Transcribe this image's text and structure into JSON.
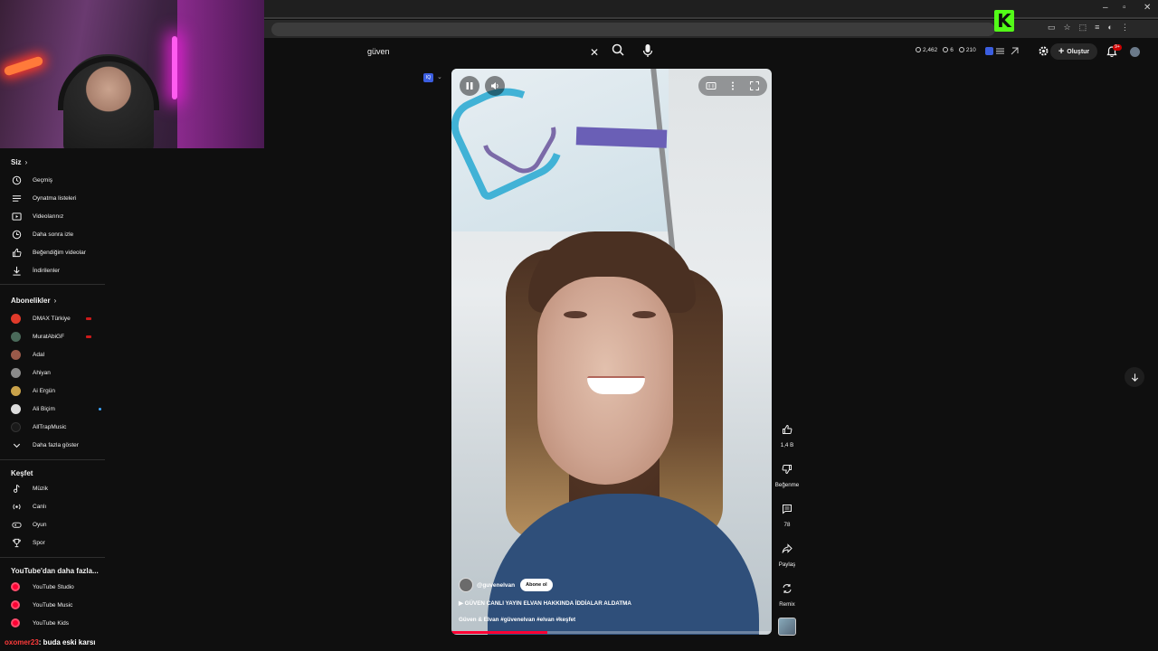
{
  "search": {
    "value": "güven"
  },
  "header": {
    "stats": [
      "2,462",
      "6",
      "210"
    ],
    "create_label": "Oluştur",
    "notification_badge": "9+"
  },
  "sidebar": {
    "you_title": "Siz",
    "you_items": [
      {
        "label": "Geçmiş",
        "icon": "history-icon"
      },
      {
        "label": "Oynatma listeleri",
        "icon": "playlist-icon"
      },
      {
        "label": "Videolarınız",
        "icon": "your-videos-icon"
      },
      {
        "label": "Daha sonra izle",
        "icon": "watch-later-icon"
      },
      {
        "label": "Beğendiğim videolar",
        "icon": "thumb-up-icon"
      },
      {
        "label": "İndirilenler",
        "icon": "download-icon"
      }
    ],
    "subs_title": "Abonelikler",
    "subscriptions": [
      {
        "label": "DMAX Türkiye",
        "color": "#e03a2a",
        "live": true
      },
      {
        "label": "MuratAbiGF",
        "color": "#4a6a5a",
        "live": true
      },
      {
        "label": "Adal",
        "color": "#9a5a4a"
      },
      {
        "label": "Ahiyan",
        "color": "#8a8a8a"
      },
      {
        "label": "Ai Ergün",
        "color": "#c9a24a"
      },
      {
        "label": "Ali Biçim",
        "color": "#dcdcdc",
        "new": true
      },
      {
        "label": "AllTrapMusic",
        "color": "#1a1a1a"
      }
    ],
    "show_more": "Daha fazla göster",
    "explore_title": "Keşfet",
    "explore": [
      {
        "label": "Müzik",
        "icon": "music-icon"
      },
      {
        "label": "Canlı",
        "icon": "live-icon"
      },
      {
        "label": "Oyun",
        "icon": "gaming-icon"
      },
      {
        "label": "Spor",
        "icon": "trophy-icon"
      }
    ],
    "more_title": "YouTube'dan daha fazla...",
    "more": [
      {
        "label": "YouTube Studio"
      },
      {
        "label": "YouTube Music"
      },
      {
        "label": "YouTube Kids"
      }
    ]
  },
  "chat": {
    "user": "oxomer23",
    "message": ": buda eski karsı"
  },
  "short": {
    "channel": "@guvenelvan",
    "subscribe_label": "Abone ol",
    "title": "▶ GÜVEN CANLI YAYIN ELVAN HAKKINDA İDDİALAR ALDATMA",
    "desc_prefix": "Güven & Elvan ",
    "desc_tags": "#güvenelvan #elvan #keşfet",
    "progress": 0.3,
    "accent": "#ff0033"
  },
  "actions": {
    "like_count": "1,4 B",
    "dislike_label": "Beğenme",
    "comment_count": "78",
    "share_label": "Paylaş",
    "remix_label": "Remix"
  }
}
